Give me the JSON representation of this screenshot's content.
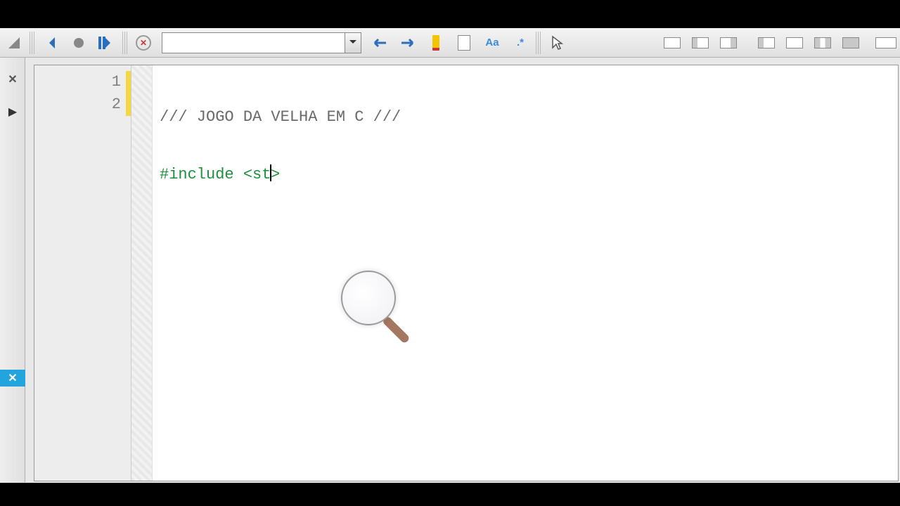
{
  "toolbar": {
    "search_value": "",
    "search_placeholder": ""
  },
  "buttons": {
    "nav_back": "Back",
    "nav_marker": "Toggle bookmark",
    "nav_step": "Step",
    "clear_search": "Clear",
    "find_prev": "Find previous",
    "find_next": "Find next",
    "highlight": "Highlight",
    "new_doc": "New document",
    "match_case": "Aa",
    "regex": ".*",
    "select_tool": "Select"
  },
  "editor": {
    "lines": {
      "l1_num": "1",
      "l2_num": "2",
      "l1_text": "/// JOGO DA VELHA EM C ///",
      "l2_before_cursor": "#include <st",
      "l2_after_cursor": ">"
    }
  },
  "left_rail": {
    "close_top": "✕",
    "expand": "▶",
    "close_blue": "✕"
  }
}
